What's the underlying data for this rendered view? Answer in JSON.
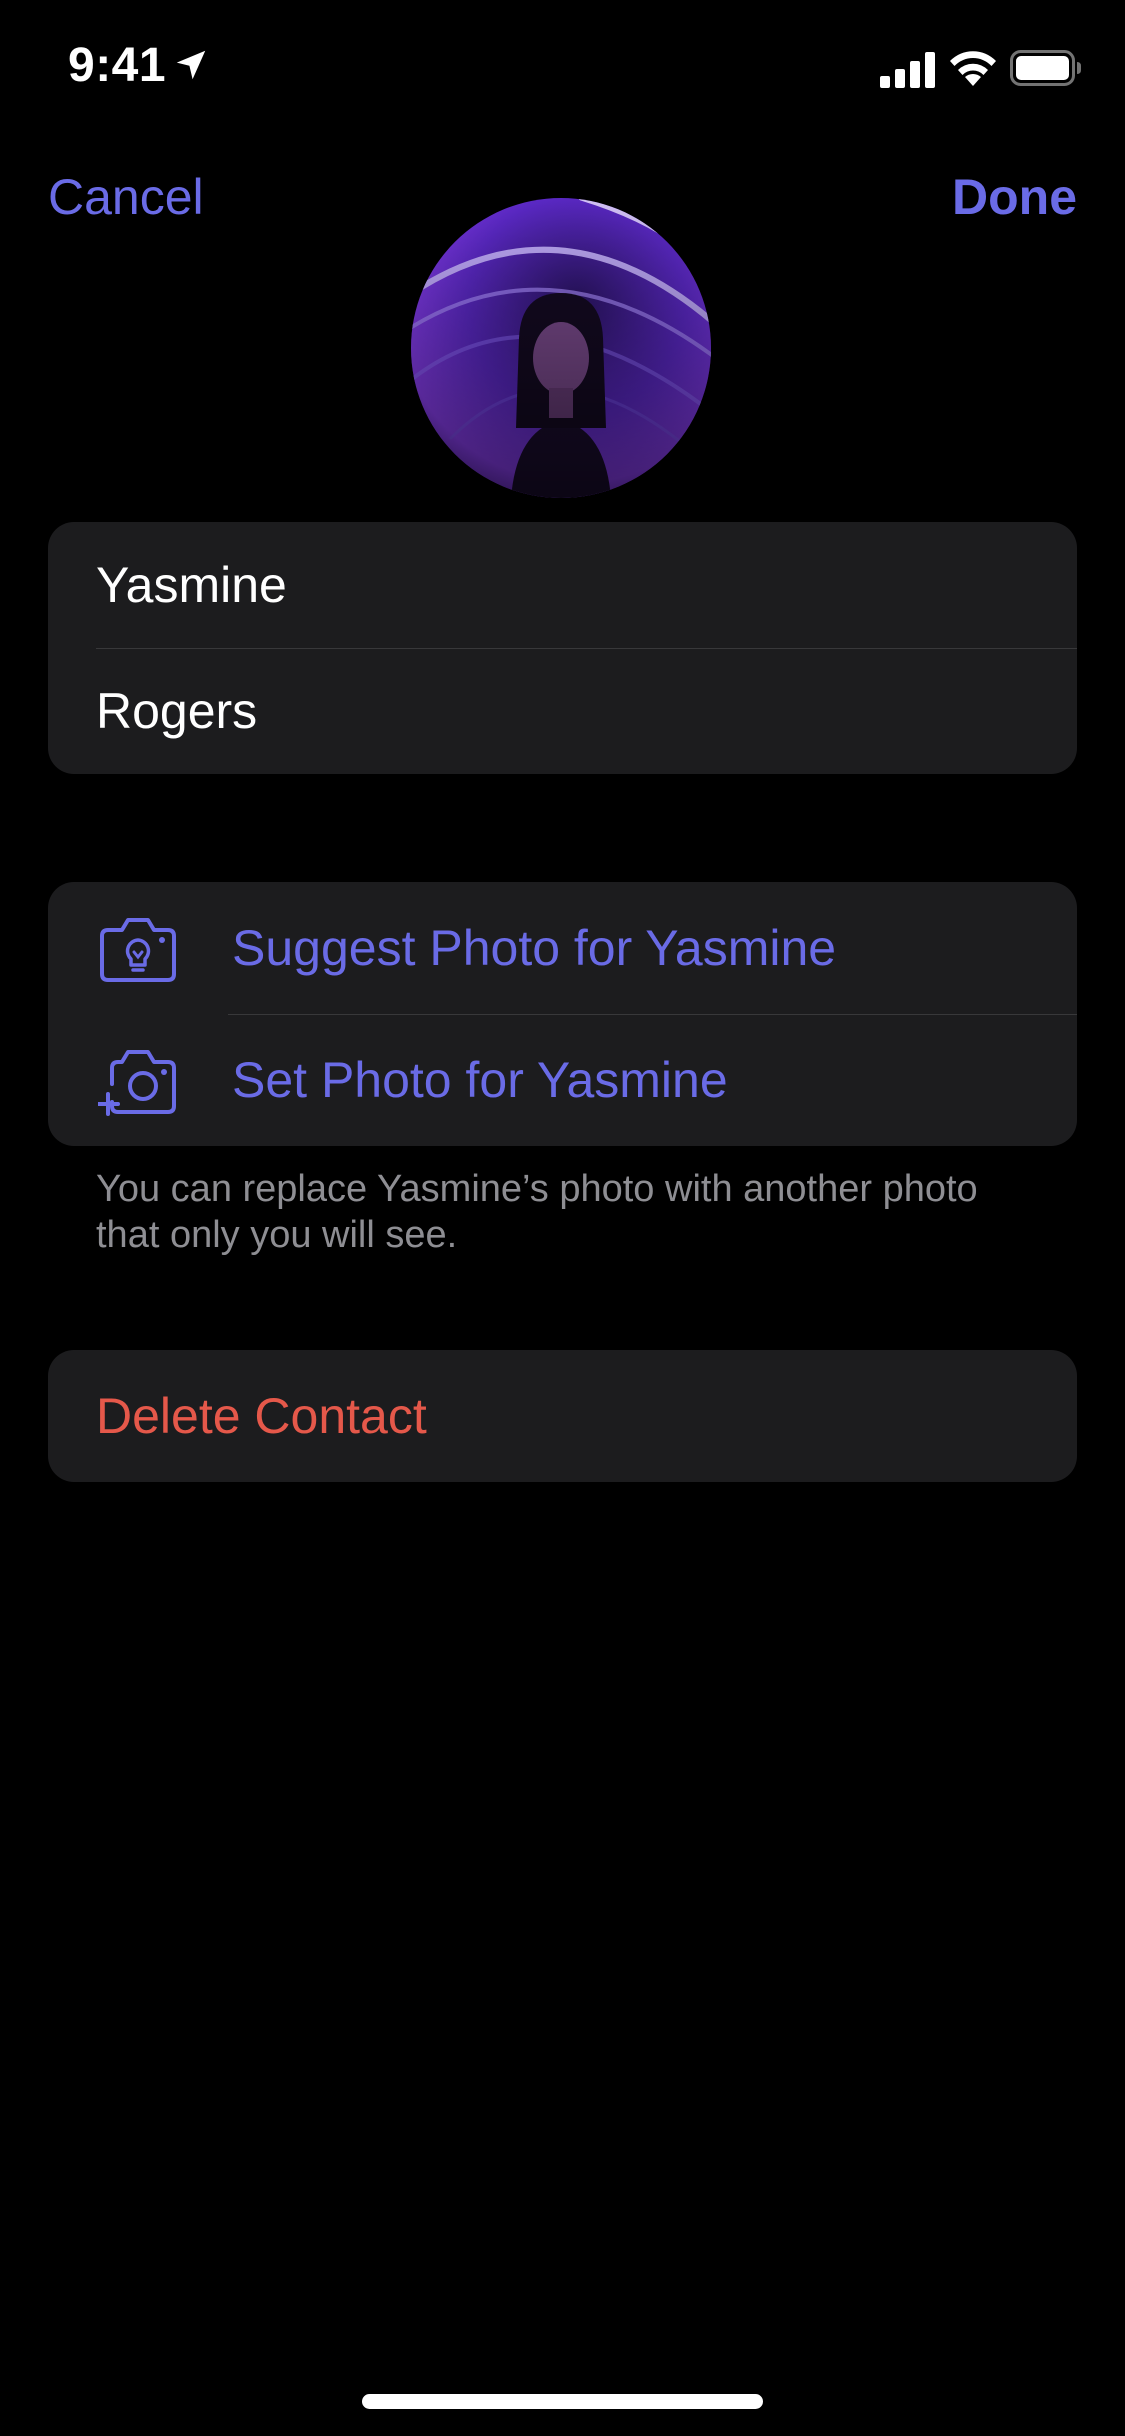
{
  "status_bar": {
    "time": "9:41",
    "icons": [
      "location-arrow-icon",
      "cellular-signal-icon",
      "wifi-icon",
      "battery-icon"
    ]
  },
  "nav": {
    "cancel_label": "Cancel",
    "done_label": "Done"
  },
  "avatar": {
    "icon": "contact-photo"
  },
  "name_fields": {
    "first_name": "Yasmine",
    "last_name": "Rogers"
  },
  "photo_actions": {
    "items": [
      {
        "label": "Suggest Photo for Yasmine",
        "icon": "camera-lightbulb-icon"
      },
      {
        "label": "Set Photo for Yasmine",
        "icon": "camera-plus-icon"
      }
    ],
    "footnote": "You can replace Yasmine’s photo with another photo that only you will see."
  },
  "delete": {
    "label": "Delete Contact"
  },
  "colors": {
    "background": "#000000",
    "card": "#1c1c1e",
    "accent": "#6a6be6",
    "destructive": "#e5584a",
    "secondary_text": "#8e8e93"
  }
}
